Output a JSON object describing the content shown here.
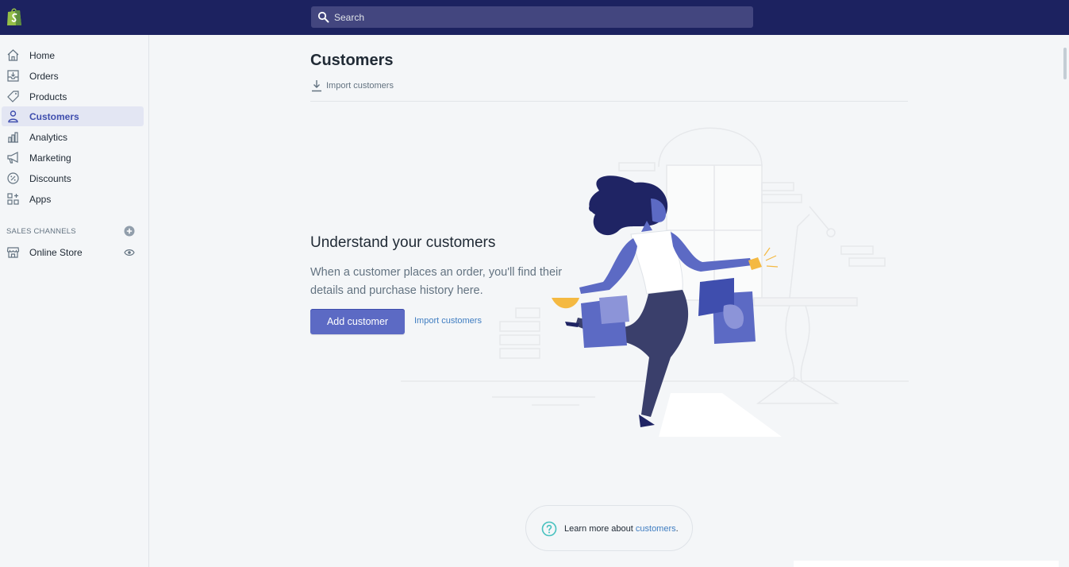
{
  "topbar": {
    "logo_icon": "shopify-bag-icon",
    "search": {
      "placeholder": "Search",
      "icon": "search-icon"
    }
  },
  "sidebar": {
    "items": [
      {
        "label": "Home",
        "icon": "home-icon"
      },
      {
        "label": "Orders",
        "icon": "orders-icon"
      },
      {
        "label": "Products",
        "icon": "tag-icon"
      },
      {
        "label": "Customers",
        "icon": "person-icon",
        "active": true
      },
      {
        "label": "Analytics",
        "icon": "bar-chart-icon"
      },
      {
        "label": "Marketing",
        "icon": "megaphone-icon"
      },
      {
        "label": "Discounts",
        "icon": "discount-icon"
      },
      {
        "label": "Apps",
        "icon": "apps-icon"
      }
    ],
    "sales_channels": {
      "heading": "SALES CHANNELS",
      "add_icon": "plus-circle-icon",
      "items": [
        {
          "label": "Online Store",
          "icon": "store-icon",
          "action_icon": "eye-icon"
        }
      ]
    }
  },
  "main": {
    "title": "Customers",
    "import_action": "Import customers",
    "empty_state": {
      "heading": "Understand your customers",
      "description": "When a customer places an order, you'll find their details and purchase history here.",
      "primary_button": "Add customer",
      "secondary_link": "Import customers",
      "illustration": "woman-with-shopping-bags-illustration"
    },
    "help": {
      "prefix": "Learn more about ",
      "link": "customers",
      "suffix": ".",
      "icon": "question-circle-icon"
    }
  },
  "colors": {
    "topbar": "#1c2260",
    "primary": "#5c6ac4",
    "active_nav": "#e3e6f3",
    "link": "#3f7dc1"
  }
}
